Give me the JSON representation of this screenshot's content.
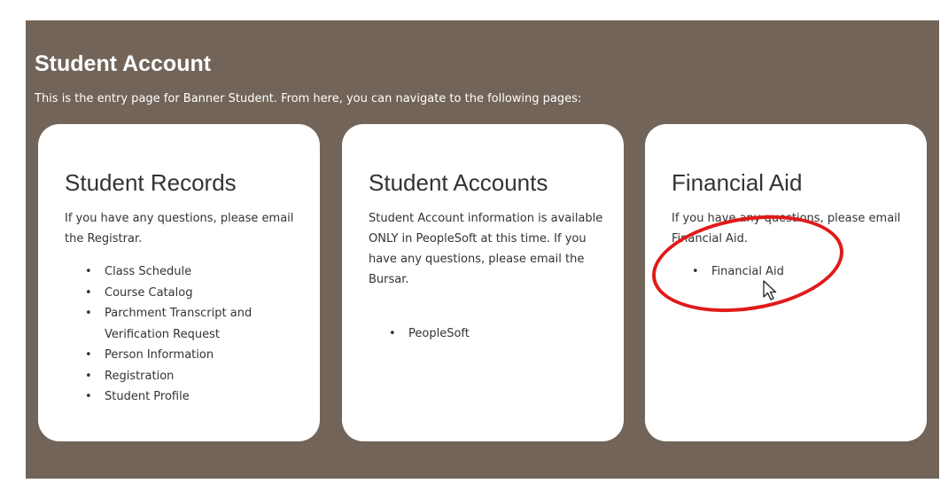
{
  "panel": {
    "title": "Student Account",
    "subtitle": "This is the entry page for Banner Student. From here, you can navigate to the following pages:",
    "background_color": "#726458"
  },
  "cards": [
    {
      "title": "Student Records",
      "description": "If you have any questions, please email the Registrar.",
      "links": [
        "Class Schedule",
        "Course Catalog",
        "Parchment Transcript and Verification Request",
        "Person Information",
        "Registration",
        "Student Profile"
      ]
    },
    {
      "title": "Student Accounts",
      "description": "Student Account information is available ONLY in PeopleSoft at this time. If you have any questions, please email the Bursar.",
      "links": [
        "PeopleSoft"
      ]
    },
    {
      "title": "Financial Aid",
      "description": "If you have any questions, please email Financial Aid.",
      "links": [
        "Financial Aid"
      ]
    }
  ],
  "annotation": {
    "shape": "red-circle",
    "color": "#e01a1a"
  },
  "cursor": {
    "icon": "mouse-pointer-icon"
  }
}
